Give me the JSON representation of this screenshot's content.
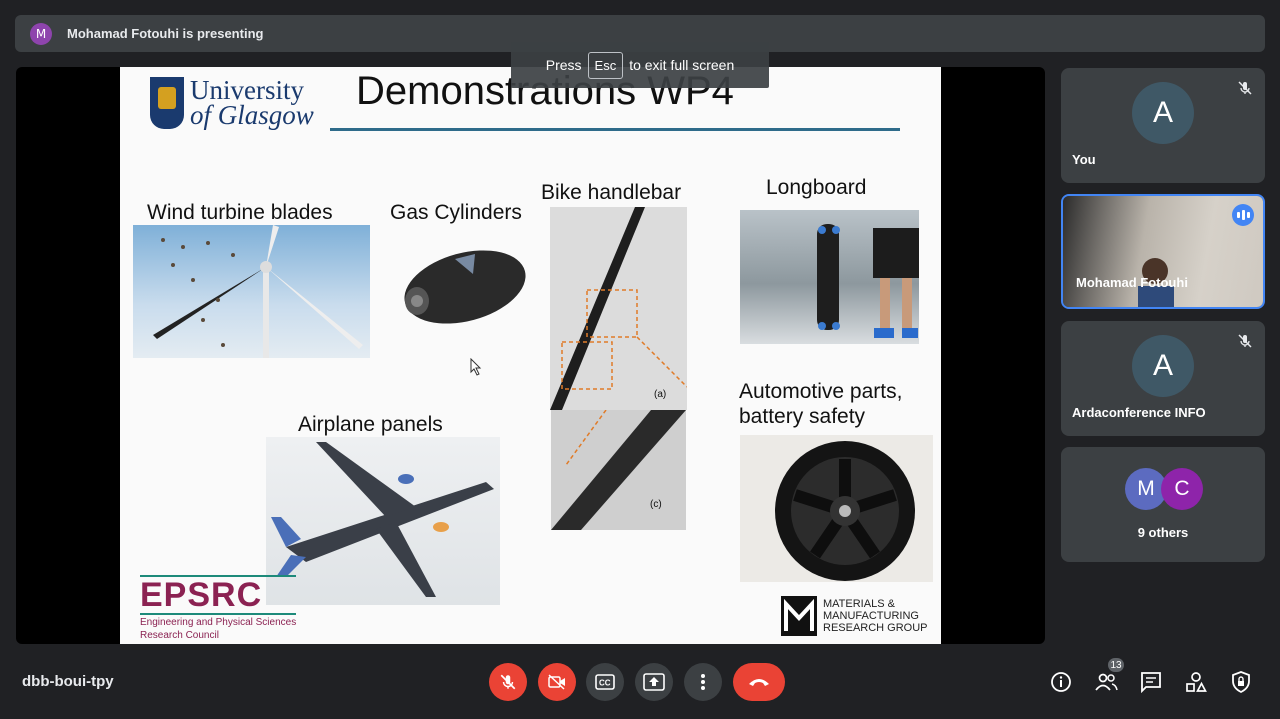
{
  "presenter_bar": {
    "avatar_letter": "M",
    "presenting_text": "Mohamad Fotouhi is presenting"
  },
  "fullscreen_hint": {
    "press": "Press",
    "key": "Esc",
    "rest": "to exit full screen"
  },
  "slide": {
    "university_line1": "University",
    "university_line2": "of Glasgow",
    "title": "Demonstrations WP4",
    "labels": {
      "wind": "Wind turbine blades",
      "gas": "Gas Cylinders",
      "bike": "Bike handlebar",
      "longboard": "Longboard",
      "airplane": "Airplane panels",
      "automotive_line1": "Automotive parts,",
      "automotive_line2": "battery safety"
    },
    "bike_marker_a": "(a)",
    "bike_marker_c": "(c)",
    "epsrc_logo": "EPSRC",
    "epsrc_line1": "Engineering and Physical Sciences",
    "epsrc_line2": "Research Council",
    "mmrg_line1": "MATERIALS &",
    "mmrg_line2": "MANUFACTURING",
    "mmrg_line3": "RESEARCH GROUP"
  },
  "participants": [
    {
      "letter": "A",
      "name": "You",
      "muted": true
    },
    {
      "name": "Mohamad Fotouhi",
      "speaking": true
    },
    {
      "letter": "A",
      "name": "Ardaconference INFO",
      "muted": true
    },
    {
      "letters": [
        "M",
        "C"
      ],
      "name": "9 others"
    }
  ],
  "bottom": {
    "meeting_code": "dbb-boui-tpy",
    "people_count": "13"
  },
  "colors": {
    "end_call": "#ea4335",
    "accent_blue": "#4285f4",
    "avatar_m": "#5c6bc0",
    "avatar_c": "#8e24aa"
  }
}
